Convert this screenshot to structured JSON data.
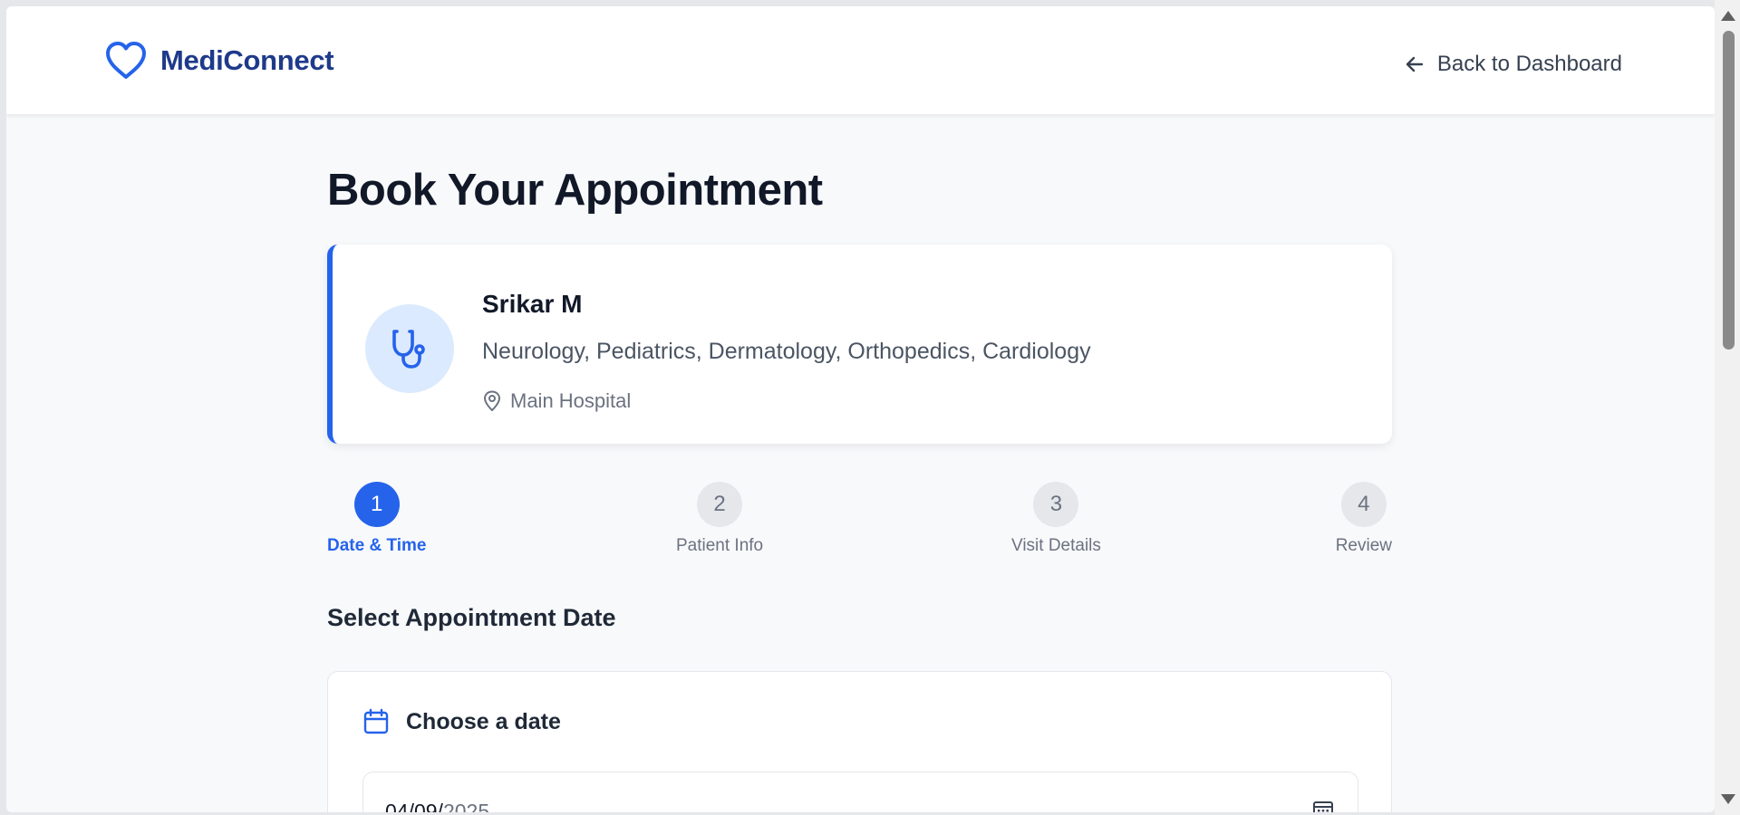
{
  "header": {
    "brand_name": "MediConnect",
    "back_label": "Back to Dashboard"
  },
  "page": {
    "title": "Book Your Appointment"
  },
  "doctor": {
    "name": "Srikar M",
    "specialties": "Neurology, Pediatrics, Dermatology, Orthopedics, Cardiology",
    "location": "Main Hospital"
  },
  "steps": [
    {
      "number": "1",
      "label": "Date & Time",
      "active": true
    },
    {
      "number": "2",
      "label": "Patient Info",
      "active": false
    },
    {
      "number": "3",
      "label": "Visit Details",
      "active": false
    },
    {
      "number": "4",
      "label": "Review",
      "active": false
    }
  ],
  "date_section": {
    "heading": "Select Appointment Date",
    "card_title": "Choose a date",
    "value_day_month": "04/09/",
    "value_year": "2025"
  },
  "colors": {
    "accent": "#2563eb",
    "brand_text": "#1e3a8a",
    "background": "#f8f9fb"
  },
  "icons": {
    "brand": "heart-icon",
    "back": "arrow-left-icon",
    "doctor": "stethoscope-icon",
    "location": "map-pin-icon",
    "date_card": "calendar-icon",
    "date_picker": "calendar-grid-icon"
  }
}
